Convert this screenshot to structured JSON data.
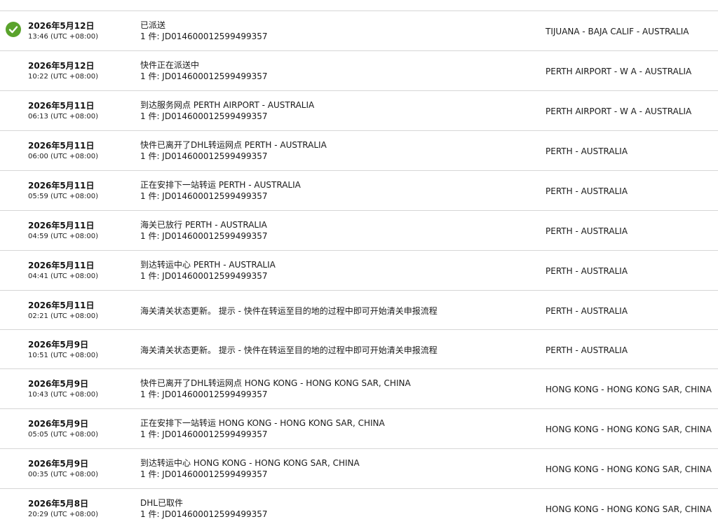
{
  "accent_color": "#5aa32c",
  "events": [
    {
      "date": "2026年5月12日",
      "time": "13:46 (UTC +08:00)",
      "status": "已派送",
      "pieces": "1 件: JD014600012599499357",
      "location": "TIJUANA - BAJA CALIF - AUSTRALIA",
      "delivered_icon": "check-circle-icon"
    },
    {
      "date": "2026年5月12日",
      "time": "10:22 (UTC +08:00)",
      "status": "快件正在派送中",
      "pieces": "1 件: JD014600012599499357",
      "location": "PERTH AIRPORT - W A - AUSTRALIA"
    },
    {
      "date": "2026年5月11日",
      "time": "06:13 (UTC +08:00)",
      "status": "到达服务网点 PERTH AIRPORT - AUSTRALIA",
      "pieces": "1 件: JD014600012599499357",
      "location": "PERTH AIRPORT - W A - AUSTRALIA"
    },
    {
      "date": "2026年5月11日",
      "time": "06:00 (UTC +08:00)",
      "status": "快件已离开了DHL转运网点 PERTH - AUSTRALIA",
      "pieces": "1 件: JD014600012599499357",
      "location": "PERTH - AUSTRALIA"
    },
    {
      "date": "2026年5月11日",
      "time": "05:59 (UTC +08:00)",
      "status": "正在安排下一站转运 PERTH - AUSTRALIA",
      "pieces": "1 件: JD014600012599499357",
      "location": "PERTH - AUSTRALIA"
    },
    {
      "date": "2026年5月11日",
      "time": "04:59 (UTC +08:00)",
      "status": "海关已放行 PERTH - AUSTRALIA",
      "pieces": "1 件: JD014600012599499357",
      "location": "PERTH - AUSTRALIA"
    },
    {
      "date": "2026年5月11日",
      "time": "04:41 (UTC +08:00)",
      "status": "到达转运中心 PERTH - AUSTRALIA",
      "pieces": "1 件: JD014600012599499357",
      "location": "PERTH - AUSTRALIA"
    },
    {
      "date": "2026年5月11日",
      "time": "02:21 (UTC +08:00)",
      "status": "海关清关状态更新。 提示 - 快件在转运至目的地的过程中即可开始清关申报流程",
      "pieces": "",
      "location": "PERTH - AUSTRALIA"
    },
    {
      "date": "2026年5月9日",
      "time": "10:51 (UTC +08:00)",
      "status": "海关清关状态更新。 提示 - 快件在转运至目的地的过程中即可开始清关申报流程",
      "pieces": "",
      "location": "PERTH - AUSTRALIA"
    },
    {
      "date": "2026年5月9日",
      "time": "10:43 (UTC +08:00)",
      "status": "快件已离开了DHL转运网点 HONG KONG - HONG KONG SAR, CHINA",
      "pieces": "1 件: JD014600012599499357",
      "location": "HONG KONG - HONG KONG SAR, CHINA"
    },
    {
      "date": "2026年5月9日",
      "time": "05:05 (UTC +08:00)",
      "status": "正在安排下一站转运 HONG KONG - HONG KONG SAR, CHINA",
      "pieces": "1 件: JD014600012599499357",
      "location": "HONG KONG - HONG KONG SAR, CHINA"
    },
    {
      "date": "2026年5月9日",
      "time": "00:35 (UTC +08:00)",
      "status": "到达转运中心 HONG KONG - HONG KONG SAR, CHINA",
      "pieces": "1 件: JD014600012599499357",
      "location": "HONG KONG - HONG KONG SAR, CHINA"
    },
    {
      "date": "2026年5月8日",
      "time": "20:29 (UTC +08:00)",
      "status": "DHL已取件",
      "pieces": "1 件: JD014600012599499357",
      "location": "HONG KONG - HONG KONG SAR, CHINA"
    }
  ]
}
